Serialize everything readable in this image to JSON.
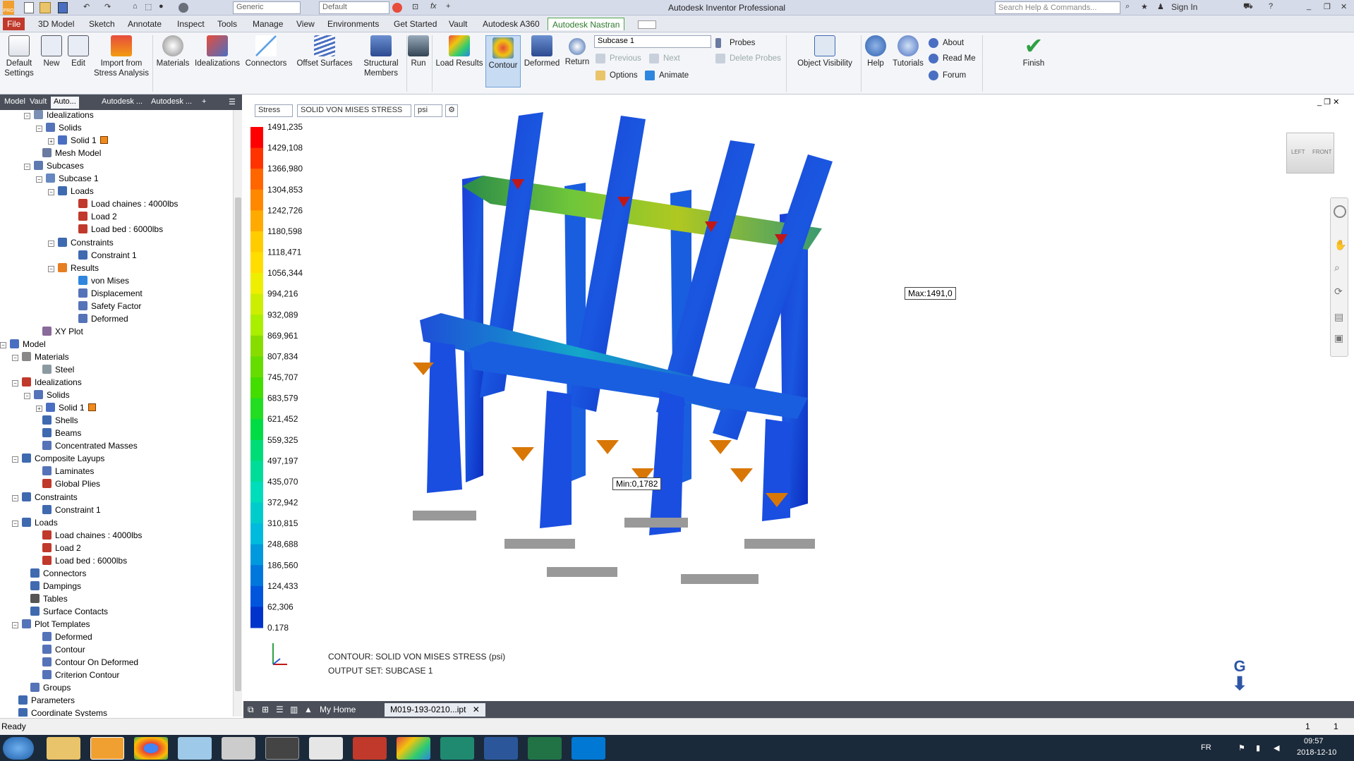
{
  "titlebar": {
    "title": "Autodesk Inventor Professional",
    "material_combo": "Generic",
    "appearance_combo": "Default",
    "search_placeholder": "Search Help & Commands...",
    "sign_in": "Sign In",
    "app_badge": "PRO"
  },
  "menu": {
    "file": "File",
    "tabs": [
      "3D Model",
      "Sketch",
      "Annotate",
      "Inspect",
      "Tools",
      "Manage",
      "View",
      "Environments",
      "Get Started",
      "Vault",
      "Autodesk A360",
      "Autodesk Nastran"
    ]
  },
  "ribbon": {
    "default_settings": "Default Settings",
    "new": "New",
    "edit": "Edit",
    "import": "Import from Stress Analysis",
    "materials": "Materials",
    "idealizations": "Idealizations",
    "connectors": "Connectors",
    "offset_surfaces": "Offset Surfaces",
    "structural_members": "Structural Members",
    "run": "Run",
    "load_results": "Load Results",
    "contour": "Contour",
    "deformed": "Deformed",
    "return": "Return",
    "subcase_combo": "Subcase 1",
    "previous": "Previous",
    "next": "Next",
    "options": "Options",
    "animate": "Animate",
    "probes": "Probes",
    "delete_probes": "Delete Probes",
    "object_visibility": "Object Visibility",
    "help": "Help",
    "tutorials": "Tutorials",
    "about": "About",
    "read_me": "Read Me",
    "forum": "Forum",
    "finish": "Finish"
  },
  "browser_tabs": [
    "Model",
    "Vault",
    "Auto...",
    "Autodesk ...",
    "Autodesk ...",
    "+"
  ],
  "tree": [
    {
      "label": "Idealizations",
      "level": 3,
      "expander": "−",
      "icon": "#7a8fb3"
    },
    {
      "label": "Solids",
      "level": 4,
      "expander": "−",
      "icon": "#5573b8"
    },
    {
      "label": "Solid 1",
      "level": 5,
      "expander": "+",
      "icon": "#4a6fc2",
      "swatch": true
    },
    {
      "label": "Mesh Model",
      "level": 3,
      "expander": "",
      "icon": "#6a7aa0"
    },
    {
      "label": "Subcases",
      "level": 3,
      "expander": "−",
      "icon": "#5e79b0"
    },
    {
      "label": "Subcase 1",
      "level": 4,
      "expander": "−",
      "icon": "#6687c0"
    },
    {
      "label": "Loads",
      "level": 5,
      "expander": "−",
      "icon": "#3f6ab0"
    },
    {
      "label": "Load  chaines : 4000lbs",
      "level": 6,
      "expander": "",
      "icon": "#c0392b"
    },
    {
      "label": "Load 2",
      "level": 6,
      "expander": "",
      "icon": "#c0392b"
    },
    {
      "label": "Load bed : 6000lbs",
      "level": 6,
      "expander": "",
      "icon": "#c0392b"
    },
    {
      "label": "Constraints",
      "level": 5,
      "expander": "−",
      "icon": "#3f6ab0"
    },
    {
      "label": "Constraint 1",
      "level": 6,
      "expander": "",
      "icon": "#3f6ab0"
    },
    {
      "label": "Results",
      "level": 5,
      "expander": "−",
      "icon": "#e67e22"
    },
    {
      "label": "von Mises",
      "level": 6,
      "expander": "",
      "icon": "#2e86de"
    },
    {
      "label": "Displacement",
      "level": 6,
      "expander": "",
      "icon": "#5573b8"
    },
    {
      "label": "Safety Factor",
      "level": 6,
      "expander": "",
      "icon": "#5573b8"
    },
    {
      "label": "Deformed",
      "level": 6,
      "expander": "",
      "icon": "#5573b8"
    },
    {
      "label": "XY Plot",
      "level": 3,
      "expander": "",
      "icon": "#8a6a9a"
    },
    {
      "label": "Model",
      "level": 1,
      "expander": "−",
      "icon": "#4a6fc2"
    },
    {
      "label": "Materials",
      "level": 2,
      "expander": "−",
      "icon": "#888888"
    },
    {
      "label": "Steel",
      "level": 3,
      "expander": "",
      "icon": "#8a9aa0"
    },
    {
      "label": "Idealizations",
      "level": 2,
      "expander": "−",
      "icon": "#c0392b"
    },
    {
      "label": "Solids",
      "level": 3,
      "expander": "−",
      "icon": "#5573b8"
    },
    {
      "label": "Solid 1",
      "level": 4,
      "expander": "+",
      "icon": "#4a6fc2",
      "swatch": true
    },
    {
      "label": "Shells",
      "level": 3,
      "expander": "",
      "icon": "#3f6ab0"
    },
    {
      "label": "Beams",
      "level": 3,
      "expander": "",
      "icon": "#3f6ab0"
    },
    {
      "label": "Concentrated Masses",
      "level": 3,
      "expander": "",
      "icon": "#5573b8"
    },
    {
      "label": "Composite Layups",
      "level": 2,
      "expander": "−",
      "icon": "#3f6ab0"
    },
    {
      "label": "Laminates",
      "level": 3,
      "expander": "",
      "icon": "#5573b8"
    },
    {
      "label": "Global Plies",
      "level": 3,
      "expander": "",
      "icon": "#c0392b"
    },
    {
      "label": "Constraints",
      "level": 2,
      "expander": "−",
      "icon": "#3f6ab0"
    },
    {
      "label": "Constraint 1",
      "level": 3,
      "expander": "",
      "icon": "#3f6ab0"
    },
    {
      "label": "Loads",
      "level": 2,
      "expander": "−",
      "icon": "#3f6ab0"
    },
    {
      "label": "Load  chaines : 4000lbs",
      "level": 3,
      "expander": "",
      "icon": "#c0392b"
    },
    {
      "label": "Load 2",
      "level": 3,
      "expander": "",
      "icon": "#c0392b"
    },
    {
      "label": "Load bed : 6000lbs",
      "level": 3,
      "expander": "",
      "icon": "#c0392b"
    },
    {
      "label": "Connectors",
      "level": 2,
      "expander": "",
      "icon": "#3f6ab0"
    },
    {
      "label": "Dampings",
      "level": 2,
      "expander": "",
      "icon": "#3f6ab0"
    },
    {
      "label": "Tables",
      "level": 2,
      "expander": "",
      "icon": "#555555"
    },
    {
      "label": "Surface Contacts",
      "level": 2,
      "expander": "",
      "icon": "#3f6ab0"
    },
    {
      "label": "Plot Templates",
      "level": 2,
      "expander": "−",
      "icon": "#5573b8"
    },
    {
      "label": "Deformed",
      "level": 3,
      "expander": "",
      "icon": "#5573b8"
    },
    {
      "label": "Contour",
      "level": 3,
      "expander": "",
      "icon": "#5573b8"
    },
    {
      "label": "Contour On Deformed",
      "level": 3,
      "expander": "",
      "icon": "#5573b8"
    },
    {
      "label": "Criterion Contour",
      "level": 3,
      "expander": "",
      "icon": "#5573b8"
    },
    {
      "label": "Groups",
      "level": 2,
      "expander": "",
      "icon": "#5573b8"
    },
    {
      "label": "Parameters",
      "level": 1,
      "expander": "",
      "icon": "#3f6ab0"
    },
    {
      "label": "Coordinate Systems",
      "level": 1,
      "expander": "",
      "icon": "#3f6ab0"
    }
  ],
  "viewport": {
    "result_type": "Stress",
    "component": "SOLID VON MISES STRESS",
    "units": "psi",
    "legend_values": [
      "1491,235",
      "1429,108",
      "1366,980",
      "1304,853",
      "1242,726",
      "1180,598",
      "1118,471",
      "1056,344",
      "994,216",
      "932,089",
      "869,961",
      "807,834",
      "745,707",
      "683,579",
      "621,452",
      "559,325",
      "497,197",
      "435,070",
      "372,942",
      "310,815",
      "248,688",
      "186,560",
      "124,433",
      "62,306",
      "0,178"
    ],
    "legend_colors": [
      "#ff0000",
      "#ff3300",
      "#ff6600",
      "#ff8800",
      "#ffaa00",
      "#ffcc00",
      "#ffdd00",
      "#eeee00",
      "#ccee00",
      "#aaee00",
      "#88dd00",
      "#66dd00",
      "#44dd00",
      "#22dd22",
      "#00dd44",
      "#00dd77",
      "#00dd99",
      "#00ddbb",
      "#00cccc",
      "#00bbdd",
      "#0099dd",
      "#0077dd",
      "#0055dd",
      "#0033cc",
      "#0011bb"
    ],
    "max_label": "Max:1491,0",
    "min_label": "Min:0,1782",
    "footer_contour": "CONTOUR: SOLID VON MISES STRESS (psi)",
    "footer_output": "OUTPUT SET: SUBCASE 1",
    "viewcube_left": "LEFT",
    "viewcube_front": "FRONT",
    "gravity_label": "G"
  },
  "doc_tabs": {
    "home": "My Home",
    "file": "M019-193-0210...ipt"
  },
  "status": {
    "text": "Ready",
    "count1": "1",
    "count2": "1"
  },
  "taskbar": {
    "lang": "FR",
    "time": "09:57",
    "date": "2018-12-10",
    "icons": [
      "start-orb",
      "file-explorer",
      "inventor",
      "chrome",
      "notepad",
      "calculator",
      "terminal",
      "paint",
      "acrobat",
      "color-app",
      "vault",
      "visio",
      "excel",
      "outlook"
    ]
  }
}
